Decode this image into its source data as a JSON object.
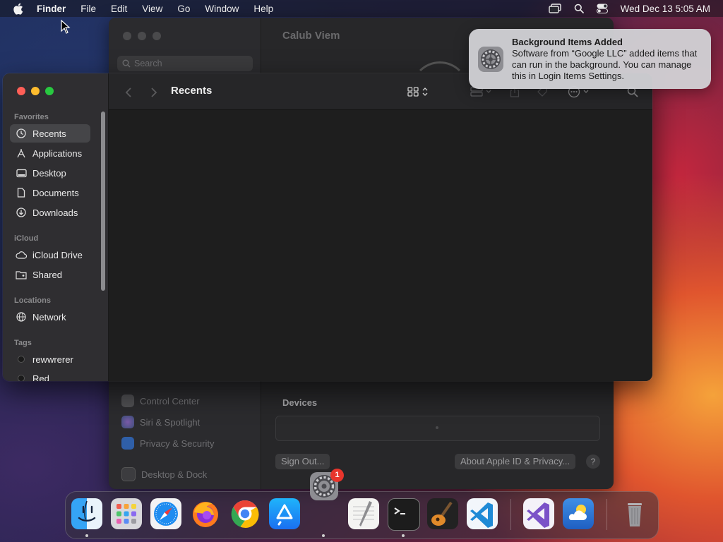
{
  "menubar": {
    "app_name": "Finder",
    "menus": [
      "File",
      "Edit",
      "View",
      "Go",
      "Window",
      "Help"
    ],
    "clock": "Wed Dec 13  5:05 AM",
    "status_icons": [
      "screen-mirroring-icon",
      "spotlight-search-icon",
      "control-center-icon"
    ]
  },
  "settings_window": {
    "title": "Calub Viem",
    "search_placeholder": "Search",
    "sidebar_items": [
      "Control Center",
      "Siri & Spotlight",
      "Privacy & Security",
      "Desktop & Dock"
    ],
    "devices_label": "Devices",
    "sign_out_label": "Sign Out...",
    "about_label": "About Apple ID & Privacy...",
    "help_label": "?"
  },
  "finder": {
    "title": "Recents",
    "sections": {
      "favorites": "Favorites",
      "icloud": "iCloud",
      "locations": "Locations",
      "tags": "Tags"
    },
    "favorites": [
      "Recents",
      "Applications",
      "Desktop",
      "Documents",
      "Downloads"
    ],
    "icloud_items": [
      "iCloud Drive",
      "Shared"
    ],
    "locations_items": [
      "Network"
    ],
    "tags": [
      "rewwrerer",
      "Red"
    ],
    "selected": "Recents"
  },
  "notification": {
    "title": "Background Items Added",
    "body": "Software from “Google LLC” added items that can run in the background. You can manage this in Login Items Settings."
  },
  "dock": {
    "apps": [
      "Finder",
      "Launchpad",
      "Safari",
      "Firefox",
      "Google Chrome",
      "App Store",
      "TextEdit",
      "Terminal",
      "GarageBand",
      "Visual Studio Code",
      "Visual Studio",
      "Weather",
      "Trash"
    ],
    "floating_app": "System Settings",
    "badge": "1"
  },
  "colors": {
    "close": "#ff5f57",
    "minimize": "#febc2e",
    "zoom": "#28c840",
    "badge": "#e8352c"
  }
}
